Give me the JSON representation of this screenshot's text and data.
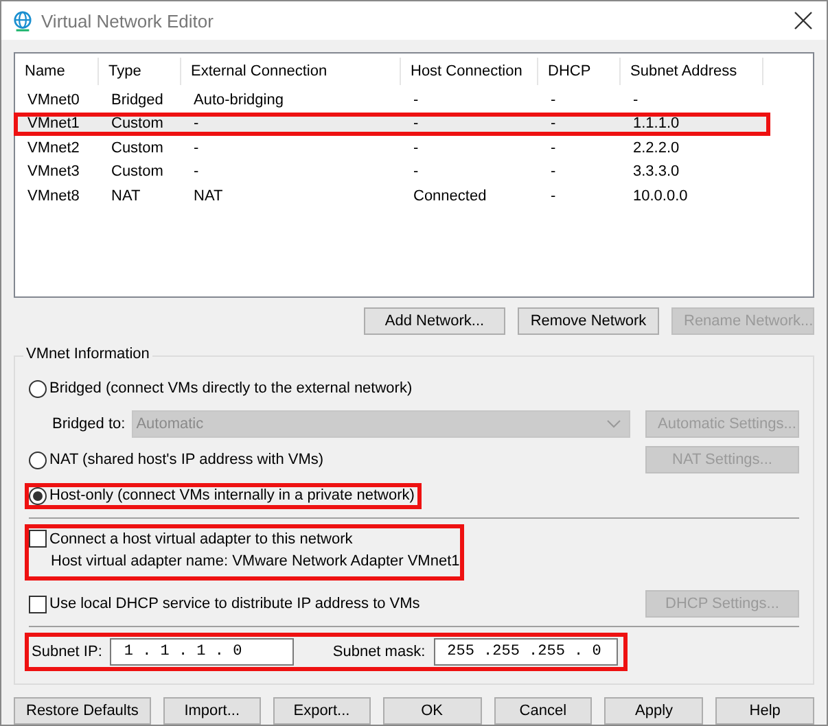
{
  "window": {
    "title": "Virtual Network Editor"
  },
  "table": {
    "columns": [
      "Name",
      "Type",
      "External Connection",
      "Host Connection",
      "DHCP",
      "Subnet Address"
    ],
    "rows": [
      {
        "cells": [
          "VMnet0",
          "Bridged",
          "Auto-bridging",
          "-",
          "-",
          "-"
        ],
        "selected": false,
        "highlighted": false
      },
      {
        "cells": [
          "VMnet1",
          "Custom",
          "-",
          "-",
          "-",
          "1.1.1.0"
        ],
        "selected": true,
        "highlighted": true
      },
      {
        "cells": [
          "VMnet2",
          "Custom",
          "-",
          "-",
          "-",
          "2.2.2.0"
        ],
        "selected": false,
        "highlighted": false
      },
      {
        "cells": [
          "VMnet3",
          "Custom",
          "-",
          "-",
          "-",
          "3.3.3.0"
        ],
        "selected": false,
        "highlighted": false
      },
      {
        "cells": [
          "VMnet8",
          "NAT",
          "NAT",
          "Connected",
          "-",
          "10.0.0.0"
        ],
        "selected": false,
        "highlighted": false
      }
    ]
  },
  "network_buttons": [
    {
      "label": "Add Network...",
      "disabled": false
    },
    {
      "label": "Remove Network",
      "disabled": false
    },
    {
      "label": "Rename Network...",
      "disabled": true
    }
  ],
  "vmnet_info": {
    "title": "VMnet Information",
    "bridged": {
      "label": "Bridged (connect VMs directly to the external network)",
      "selected": false
    },
    "bridged_to": {
      "label": "Bridged to:",
      "value": "Automatic",
      "disabled": true,
      "button": {
        "label": "Automatic Settings...",
        "disabled": true
      }
    },
    "nat": {
      "label": "NAT (shared host's IP address with VMs)",
      "selected": false,
      "button": {
        "label": "NAT Settings...",
        "disabled": true
      }
    },
    "host_only": {
      "label": "Host-only (connect VMs internally in a private network)",
      "selected": true,
      "highlighted": true
    },
    "adapter": {
      "label": "Connect a host virtual adapter to this network",
      "checked": false,
      "note": "Host virtual adapter name: VMware Network Adapter VMnet1",
      "highlighted": true
    },
    "dhcp": {
      "label": "Use local DHCP service to distribute IP address to VMs",
      "checked": false,
      "button": {
        "label": "DHCP Settings...",
        "disabled": true
      }
    },
    "subnet": {
      "highlighted": true,
      "ip_label": "Subnet IP:",
      "ip": "1 . 1 . 1 . 0",
      "mask_label": "Subnet mask:",
      "mask": "255 .255 .255 . 0"
    }
  },
  "buttons": [
    {
      "label": "Restore Defaults",
      "disabled": false
    },
    {
      "label": "Import...",
      "disabled": false
    },
    {
      "label": "Export...",
      "disabled": false
    },
    {
      "label": "OK",
      "disabled": false
    },
    {
      "label": "Cancel",
      "disabled": false
    },
    {
      "label": "Apply",
      "disabled": false
    },
    {
      "label": "Help",
      "disabled": false
    }
  ]
}
